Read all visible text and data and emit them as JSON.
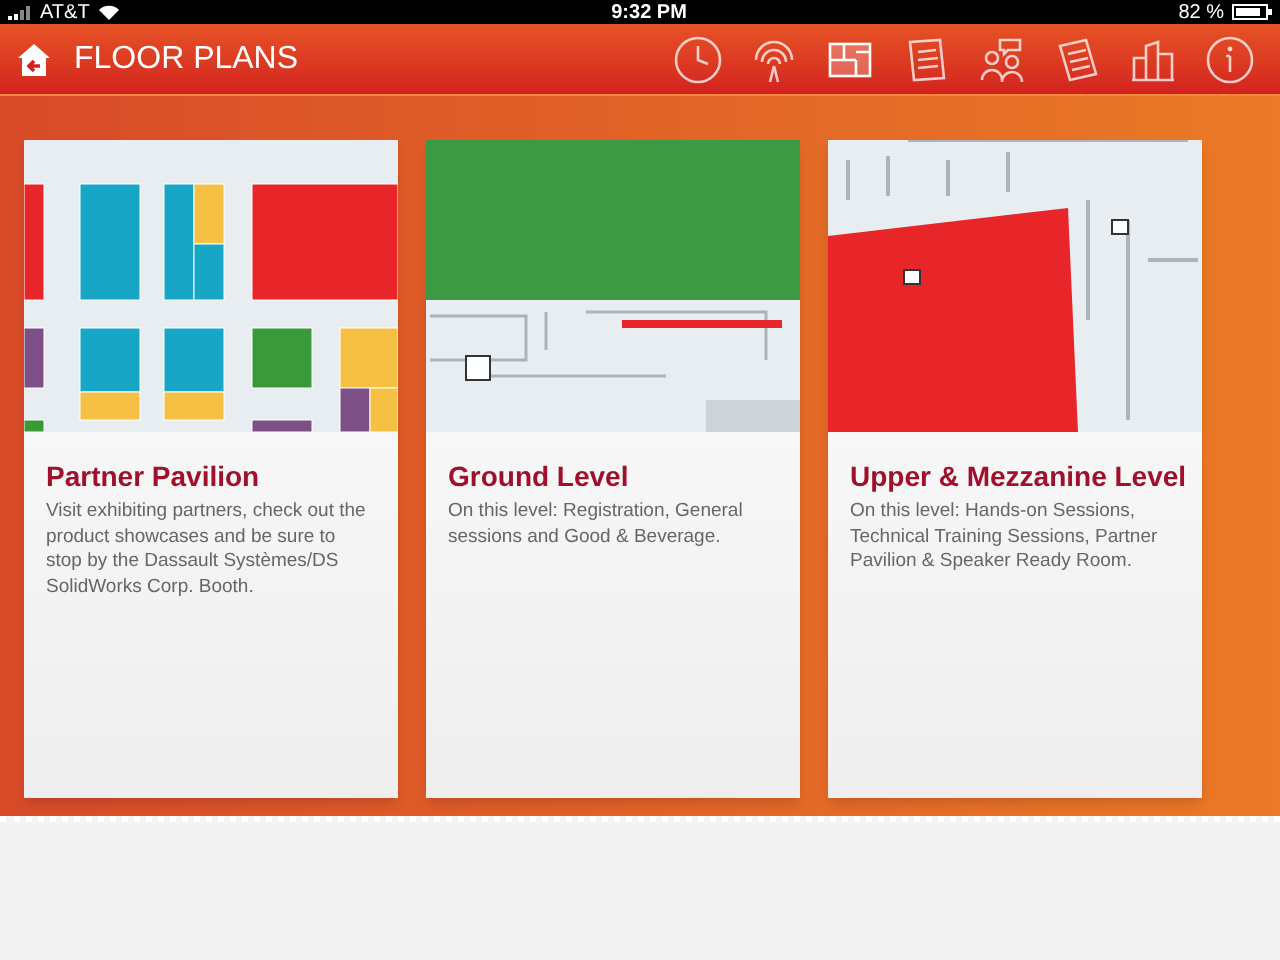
{
  "status_bar": {
    "carrier": "AT&T",
    "time": "9:32 PM",
    "battery": "82 %"
  },
  "header": {
    "title": "FLOOR PLANS"
  },
  "toolbar": [
    {
      "kind": "clock"
    },
    {
      "kind": "signal"
    },
    {
      "kind": "floorplan",
      "selected": true
    },
    {
      "kind": "notepad"
    },
    {
      "kind": "people"
    },
    {
      "kind": "document"
    },
    {
      "kind": "buildings"
    },
    {
      "kind": "info"
    }
  ],
  "cards": [
    {
      "kind": "booths",
      "title": "Partner Pavilion",
      "description": "Visit exhibiting partners, check out the product showcases and be sure to stop by the Dassault Systèmes/DS SolidWorks Corp. Booth."
    },
    {
      "kind": "ground",
      "title": "Ground Level",
      "description": "On this level: Registration, General sessions and Good & Beverage."
    },
    {
      "kind": "upper",
      "title": "Upper & Mezzanine Level",
      "description": "On this level: Hands-on Sessions, Technical Training Sessions, Partner Pavilion & Speaker Ready Room."
    }
  ]
}
